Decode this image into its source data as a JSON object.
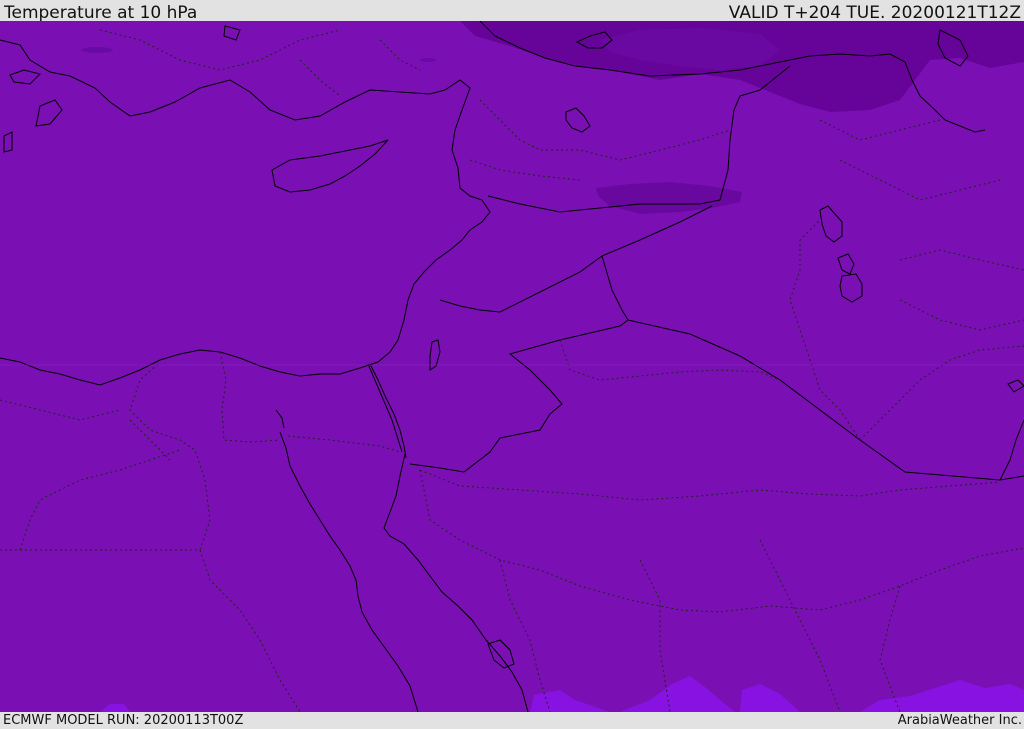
{
  "header": {
    "title": "Temperature at 10 hPa",
    "valid": "VALID T+204 TUE. 20200121T12Z"
  },
  "footer": {
    "model_run": "ECMWF MODEL RUN: 20200113T00Z",
    "credit": "ArabiaWeather Inc."
  },
  "colors": {
    "field_main": "#7a10b4",
    "field_cold": "#66049a",
    "field_warm": "#8a12e6",
    "coastline": "#000000",
    "border": "#000000",
    "background_bar": "#e2e2e2"
  }
}
